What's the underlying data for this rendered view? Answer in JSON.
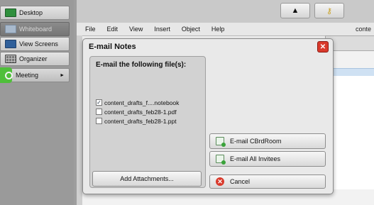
{
  "sidebar": {
    "items": [
      {
        "label": "Desktop"
      },
      {
        "label": "Whiteboard"
      },
      {
        "label": "View Screens"
      },
      {
        "label": "Organizer"
      },
      {
        "label": "Meeting"
      }
    ]
  },
  "app": {
    "menu": [
      "File",
      "Edit",
      "View",
      "Insert",
      "Object",
      "Help"
    ],
    "menu_right_text": "conte"
  },
  "dialog": {
    "title": "E-mail Notes",
    "group_title": "E-mail the following file(s):",
    "files": [
      {
        "name": "content_drafts_f....notebook",
        "checked": true
      },
      {
        "name": "content_drafts_feb28-1.pdf",
        "checked": false
      },
      {
        "name": "content_drafts_feb28-1.ppt",
        "checked": false
      }
    ],
    "add_attachments_label": "Add Attachments...",
    "email_cbrdroom_label": "E-mail CBrdRoom",
    "email_all_label": "E-mail All Invitees",
    "cancel_label": "Cancel"
  }
}
